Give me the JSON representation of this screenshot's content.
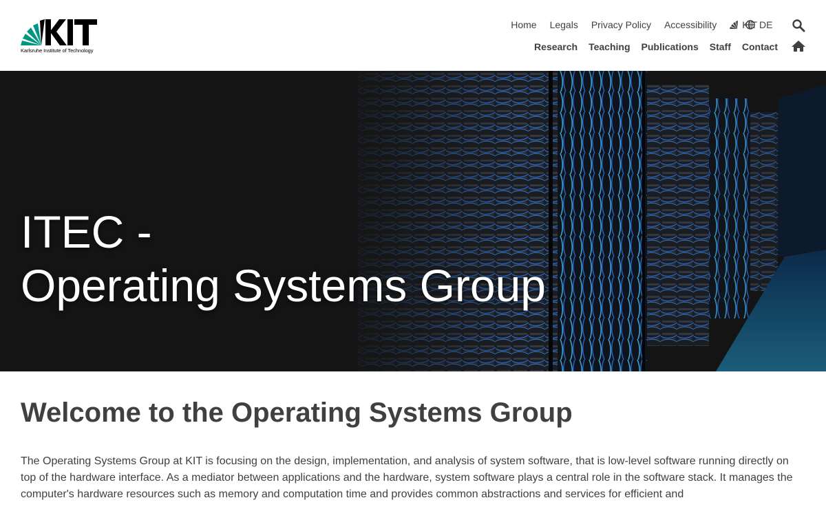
{
  "header": {
    "logo_text": "KIT",
    "logo_subtitle": "Karlsruhe Institute of Technology",
    "meta_nav": [
      {
        "label": "Home",
        "name": "meta-nav-home"
      },
      {
        "label": "Legals",
        "name": "meta-nav-legals"
      },
      {
        "label": "Privacy Policy",
        "name": "meta-nav-privacy-policy"
      },
      {
        "label": "Accessibility",
        "name": "meta-nav-accessibility"
      }
    ],
    "kit_link": "KIT",
    "language": "DE",
    "main_nav": [
      {
        "label": "Research",
        "name": "main-nav-research"
      },
      {
        "label": "Teaching",
        "name": "main-nav-teaching"
      },
      {
        "label": "Publications",
        "name": "main-nav-publications"
      },
      {
        "label": "Staff",
        "name": "main-nav-staff"
      },
      {
        "label": "Contact",
        "name": "main-nav-contact"
      }
    ]
  },
  "hero": {
    "title_line1": "ITEC -",
    "title_line2": "Operating Systems Group"
  },
  "main": {
    "heading": "Welcome to the Operating Systems Group",
    "intro": "The Operating Systems Group at KIT is focusing on the design, implementation, and analysis of system software, that is low-level software running directly on top of the hardware interface. As a mediator between applications and the hardware, system software plays a central role in the software stack. It manages the computer's hardware resources such as memory and computation time and provides common abstractions and services for efficient and"
  },
  "colors": {
    "kit_green": "#009682",
    "text": "#404040",
    "hero_bg": "#141414",
    "hero_accent": "#2a6fd6"
  },
  "icons": {
    "search": "search-icon",
    "home": "home-icon",
    "globe": "globe-icon",
    "kit_signet": "kit-signet-icon"
  }
}
